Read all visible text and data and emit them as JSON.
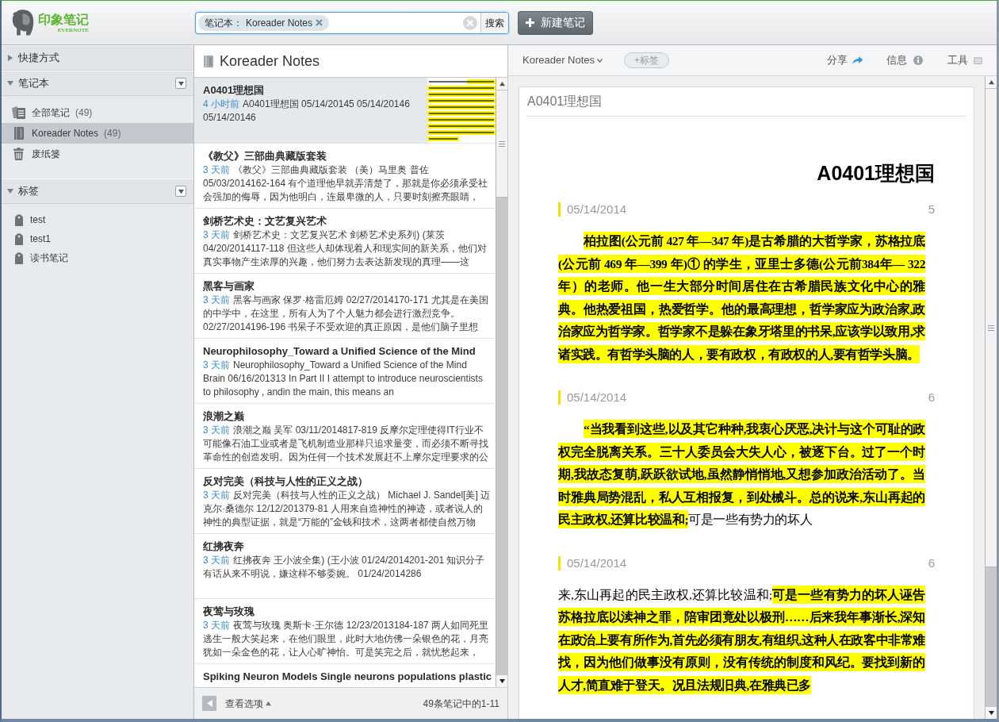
{
  "header": {
    "logo": {
      "name": "印象笔记",
      "subtitle": "EVERNOTE"
    },
    "search": {
      "filter_label": "笔记本：",
      "filter_value": "Koreader Notes",
      "button": "搜索"
    },
    "new_note_button": "新建笔记"
  },
  "sidebar": {
    "sections": [
      {
        "title": "快捷方式",
        "expanded": false
      },
      {
        "title": "笔记本",
        "expanded": true,
        "menu": true,
        "items": [
          {
            "kind": "all_notes",
            "label": "全部笔记",
            "count": "(49)",
            "selected": false
          },
          {
            "kind": "notebook",
            "label": "Koreader Notes",
            "count": "(49)",
            "selected": true
          },
          {
            "kind": "trash",
            "label": "废纸篓",
            "selected": false
          }
        ]
      },
      {
        "title": "标签",
        "expanded": true,
        "menu": true,
        "items": [
          {
            "kind": "tag",
            "label": "test",
            "selected": false
          },
          {
            "kind": "tag",
            "label": "test1",
            "selected": false
          },
          {
            "kind": "tag",
            "label": "读书笔记",
            "selected": false
          }
        ]
      }
    ]
  },
  "note_list": {
    "title": "Koreader Notes",
    "notes": [
      {
        "title": "A0401理想国",
        "time": "4 小时前",
        "snippet": "A0401理想国 05/14/20145 05/14/20146 05/14/20146",
        "selected": true,
        "thumbnail": true
      },
      {
        "title": "《教父》三部曲典藏版套装",
        "time": "3 天前",
        "snippet": "《教父》三部曲典藏版套装 （美）马里奥 普佐 05/03/2014162-164 有个道理他早就弄清楚了，那就是你必须承受社会强加的侮辱，因为他明白，连最卑微的人，只要时刻擦亮眼睛，",
        "selected": false
      },
      {
        "title": "剑桥艺术史：文艺复兴艺术",
        "time": "3 天前",
        "snippet": "剑桥艺术史：文艺复兴艺术 剑桥艺术史系列) (莱茨 04/20/2014117-118 但这些人却体现着人和现实间的新关系，他们对真实事物产生浓厚的兴趣，他们努力去表达新发现的真理——这",
        "selected": false
      },
      {
        "title": "黑客与画家",
        "time": "3 天前",
        "snippet": "黑客与画家 保罗·格雷厄姆 02/27/2014170-171 尤其是在美国的中学中，在这里，所有人为了个人魅力都会进行激烈竞争。 02/27/2014196-196 书呆子不受欢迎的真正原因，是他们脑子里想",
        "selected": false
      },
      {
        "title": "Neurophilosophy_Toward a Unified Science of the Mind",
        "time": "3 天前",
        "snippet": "Neurophilosophy_Toward a Unified Science of the Mind Brain 06/16/201313 In Part II I attempt to introduce neuroscientists to philosophy , andin the main, this means an",
        "selected": false
      },
      {
        "title": "浪潮之巅",
        "time": "3 天前",
        "snippet": "浪潮之巅 吴军 03/11/2014817-819 反摩尔定理使得IT行业不可能像石油工业或者是飞机制造业那样只追求量变，而必须不断寻找革命性的创造发明。因为任何一个技术发展赶不上摩尔定理要求的公",
        "selected": false
      },
      {
        "title": "反对完美（科技与人性的正义之战）",
        "time": "3 天前",
        "snippet": "反对完美（科技与人性的正义之战） Michael J. Sandel[美] 迈克尔·桑德尔 12/12/201379-81 人用来自造神性的神迹，或者说人的神性的典型证据，就是“万能的”金钱和技术，这两者都使自然万物",
        "selected": false
      },
      {
        "title": "红拂夜奔",
        "time": "3 天前",
        "snippet": "红拂夜奔 王小波全集) (王小波 01/24/2014201-201 知识分子有话从来不明说，嫌这样不够委婉。 01/24/2014286",
        "selected": false
      },
      {
        "title": "夜莺与玫瑰",
        "time": "3 天前",
        "snippet": "夜莺与玫瑰 奥斯卡·王尔德 12/23/2013184-187 两人如同死里逃生一般大笑起来，在他们眼里，此时大地仿佛一朵银色的花，月亮犹如一朵金色的花，让人心旷神怡。可是笑完之后，就忧愁起来，",
        "selected": false
      },
      {
        "title": "Spiking Neuron Models Single neurons populations plastic",
        "selected": false
      }
    ],
    "footer": {
      "view_options": "查看选项",
      "range": "49条笔记中的1-11"
    }
  },
  "note_view": {
    "toolbar": {
      "notebook": "Koreader Notes",
      "tag_button": "+标签",
      "share": "分享",
      "info": "信息",
      "tools": "工具"
    },
    "title_field": "A0401理想国",
    "heading": "A0401理想国",
    "highlights": [
      {
        "date": "05/14/2014",
        "page": "5",
        "indented": true,
        "segments": [
          {
            "text": "柏拉图(公元前 427 年—347 年)是古希腊的大哲学家，苏格拉底(公元前 469 年—399 年)① 的学生，亚里士多德(公元前384年— 322 年）的老师。他一生大部分时间居住在古希腊民族文化中心的雅典。他热爱祖国，热爱哲学。他的最高理想，哲学家应为政治家,政治家应为哲学家。哲学家不是躲在象牙塔里的书呆,应该学以致用,求诸实践。有哲学头脑的人，要有政权，有政权的人,要有哲学头脑。",
            "highlighted": true
          }
        ]
      },
      {
        "date": "05/14/2014",
        "page": "6",
        "indented": true,
        "segments": [
          {
            "text": "“当我看到这些,以及其它种种,我衷心厌恶,决计与这个可耻的政权完全脱离关系。三十人委员会大失人心，被逐下台。过了一个时期,我故态复萌,跃跃欲试地,虽然静悄悄地,又想参加政治活动了。当时雅典局势混乱，私人互相报复，到处械斗。总的说来,东山再起的民主政权,还算比较温和;",
            "highlighted": true
          },
          {
            "text": "可是一些有势力的坏人",
            "highlighted": false
          }
        ]
      },
      {
        "date": "05/14/2014",
        "page": "6",
        "indented": false,
        "segments": [
          {
            "text": "来,东山再起的民主政权,还算比较温和;",
            "highlighted": false
          },
          {
            "text": "可是一些有势力的坏人诬告苏格拉底以渎神之罪，陪审团竟处以极刑……后来我年事渐长,深知在政治上要有所作为,首先必须有朋友,有组织,这种人在政客中非常难找，因为他们做事没有原则，没有传统的制度和风纪。要找到新的人才,简直难于登天。况且法规旧典,在雅典已多",
            "highlighted": true
          }
        ]
      }
    ]
  }
}
